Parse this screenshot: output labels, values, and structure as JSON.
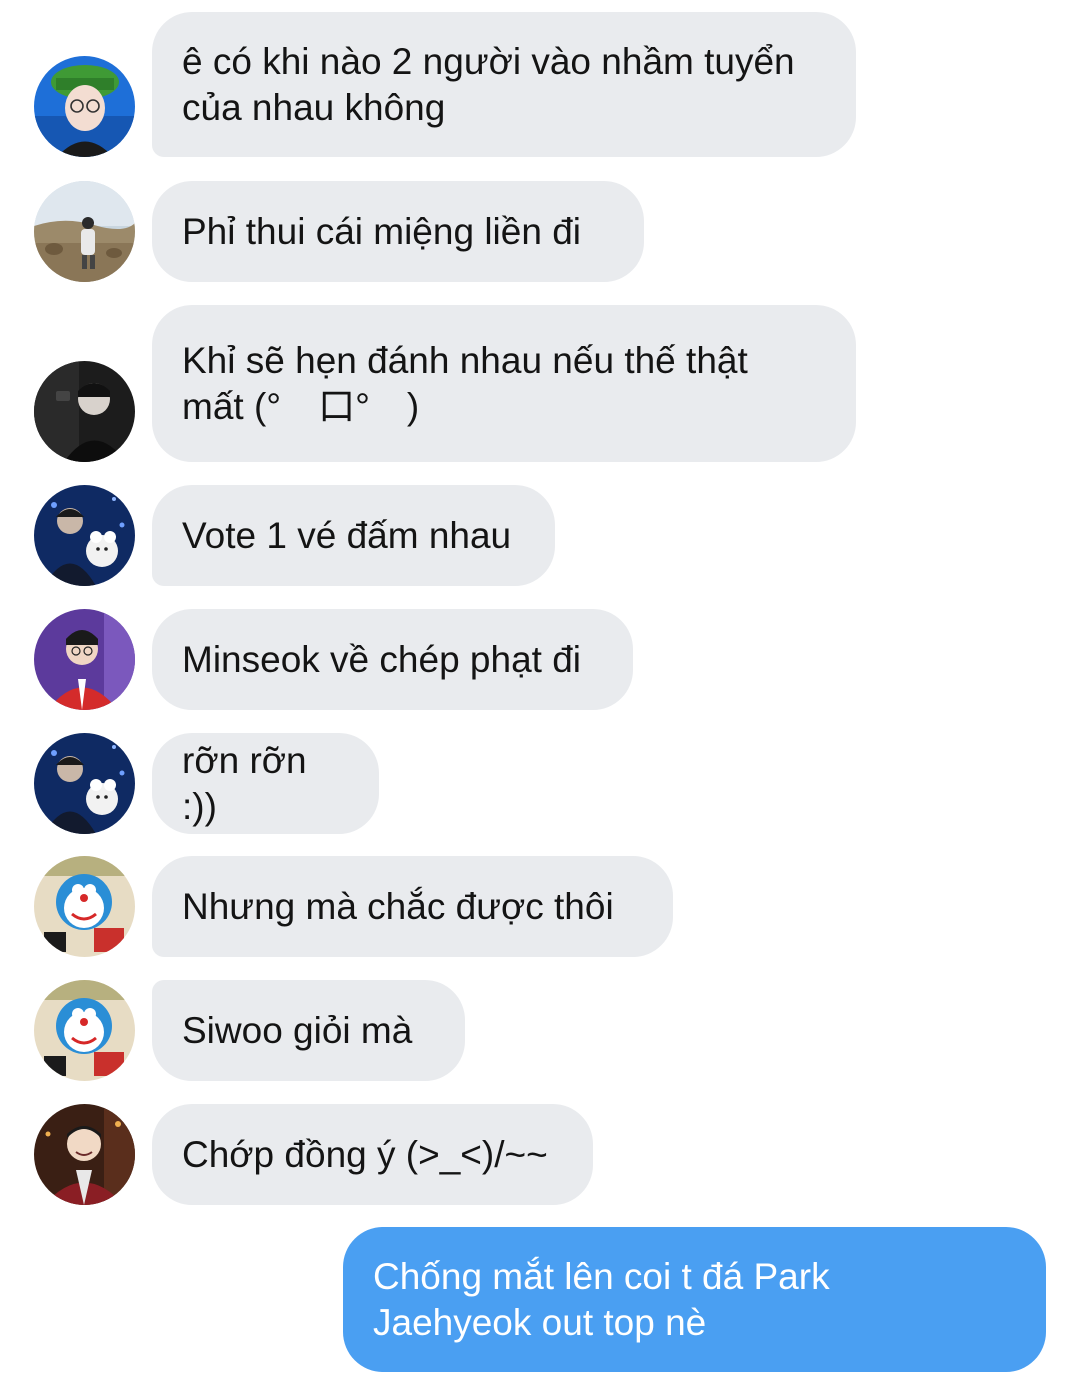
{
  "conversation": {
    "messages": [
      {
        "sender_avatar": "avatar-green-bucket-hat",
        "text": "ê có khi nào 2 người vào nhầm tuyển\ncủa nhau không"
      },
      {
        "sender_avatar": "avatar-outdoor-field",
        "text": "Phỉ thui cái miệng liền đi"
      },
      {
        "sender_avatar": "avatar-dark-portrait",
        "text": "Khỉ sẽ hẹn đánh nhau nếu thế thật\nmất (°　口°　)"
      },
      {
        "sender_avatar": "avatar-blue-plush",
        "text": "Vote 1 vé đấm nhau"
      },
      {
        "sender_avatar": "avatar-purple-red-jacket",
        "text": "Minseok về chép phạt đi"
      },
      {
        "sender_avatar": "avatar-blue-plush",
        "text": "rỡn rỡn :))"
      },
      {
        "sender_avatar": "avatar-doraemon-wall",
        "text": "Nhưng mà chắc được thôi"
      },
      {
        "sender_avatar": "avatar-doraemon-wall",
        "text": "Siwoo giỏi mà"
      },
      {
        "sender_avatar": "avatar-red-sweater-smile",
        "text": "Chớp đồng ý (>_<)/~~"
      }
    ],
    "outgoing": {
      "text": "Chống mắt lên coi t đá Park\nJaehyeok out top nè"
    }
  },
  "colors": {
    "incoming_bubble": "#e9ebee",
    "incoming_text": "#141414",
    "outgoing_bubble": "#4a9ff2",
    "outgoing_text": "#ffffff",
    "background": "#ffffff"
  }
}
